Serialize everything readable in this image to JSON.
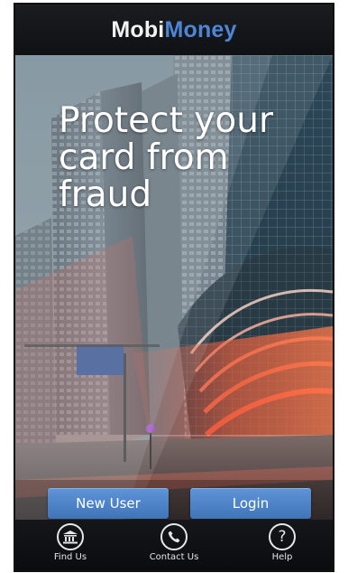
{
  "app": {
    "logo_part1": "Mobi",
    "logo_part2": "Money"
  },
  "hero": {
    "headline": "Protect your\ncard from\nfraud"
  },
  "actions": {
    "new_user_label": "New User",
    "login_label": "Login"
  },
  "tabs": [
    {
      "label": "Find Us",
      "icon": "bank-icon"
    },
    {
      "label": "Contact Us",
      "icon": "phone-icon"
    },
    {
      "label": "Help",
      "icon": "help-icon"
    }
  ],
  "colors": {
    "brand_blue": "#4e86d6",
    "button_blue": "#4f85c8",
    "header_bg": "#15161a"
  }
}
